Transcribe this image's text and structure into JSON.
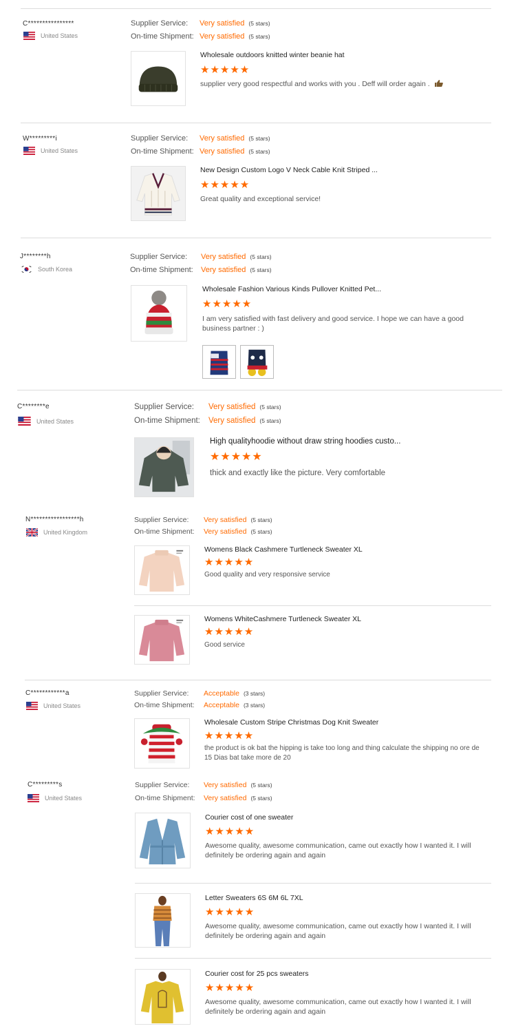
{
  "labels": {
    "supplier_service": "Supplier Service:",
    "ontime_shipment": "On-time Shipment:"
  },
  "colors": {
    "accent": "#ff6a00",
    "divider": "#dcdcdc"
  },
  "reviews": [
    {
      "buyer": "C****************",
      "country": "United States",
      "flag_icon": "us-flag-icon",
      "supplier_service": {
        "value": "Very satisfied",
        "note": "(5 stars)"
      },
      "ontime_shipment": {
        "value": "Very satisfied",
        "note": "(5 stars)"
      },
      "products": [
        {
          "title": "Wholesale outdoors knitted winter beanie hat",
          "rating": "★★★★★",
          "rating_value": 5,
          "comment": "supplier very good respectful and works with you . Deff will order again .",
          "image_icon": "beanie-hat-image"
        }
      ]
    },
    {
      "buyer": "W*********i",
      "country": "United States",
      "flag_icon": "us-flag-icon",
      "supplier_service": {
        "value": "Very satisfied",
        "note": "(5 stars)"
      },
      "ontime_shipment": {
        "value": "Very satisfied",
        "note": "(5 stars)"
      },
      "products": [
        {
          "title": "New Design Custom Logo V Neck Cable Knit Striped ...",
          "rating": "★★★★★",
          "rating_value": 5,
          "comment": "Great quality and exceptional service!",
          "image_icon": "cable-knit-sweater-image"
        }
      ]
    },
    {
      "buyer": "J********h",
      "country": "South Korea",
      "flag_icon": "south-korea-flag-icon",
      "supplier_service": {
        "value": "Very satisfied",
        "note": "(5 stars)"
      },
      "ontime_shipment": {
        "value": "Very satisfied",
        "note": "(5 stars)"
      },
      "products": [
        {
          "title": "Wholesale Fashion Various Kinds Pullover Knitted Pet...",
          "rating": "★★★★★",
          "rating_value": 5,
          "comment": "I am very satisfied with fast delivery and good service. I hope we can have a good business partner : )",
          "image_icon": "pom-pom-hat-image"
        }
      ]
    },
    {
      "buyer": "C********e",
      "country": "United States",
      "flag_icon": "us-flag-icon",
      "supplier_service": {
        "value": "Very satisfied",
        "note": "(5 stars)"
      },
      "ontime_shipment": {
        "value": "Very satisfied",
        "note": "(5 stars)"
      },
      "products": [
        {
          "title": "High qualityhoodie without draw string hoodies custo...",
          "rating": "★★★★★",
          "rating_value": 5,
          "comment": "thick and exactly like the picture. Very comfortable",
          "image_icon": "hoodie-image"
        }
      ]
    },
    {
      "buyer": "N*****************h",
      "country": "United Kingdom",
      "flag_icon": "uk-flag-icon",
      "supplier_service": {
        "value": "Very satisfied",
        "note": "(5 stars)"
      },
      "ontime_shipment": {
        "value": "Very satisfied",
        "note": "(5 stars)"
      },
      "products": [
        {
          "title": "Womens Black Cashmere Turtleneck Sweater XL",
          "rating": "★★★★★",
          "rating_value": 5,
          "comment": "Good quality and very responsive service",
          "image_icon": "beige-sweater-image"
        },
        {
          "title": "Womens WhiteCashmere Turtleneck Sweater XL",
          "rating": "★★★★★",
          "rating_value": 5,
          "comment": "Good service",
          "image_icon": "pink-sweater-image"
        }
      ]
    },
    {
      "buyer": "C************a",
      "country": "United States",
      "flag_icon": "us-flag-icon",
      "supplier_service": {
        "value": "Acceptable",
        "note": "(3 stars)"
      },
      "ontime_shipment": {
        "value": "Acceptable",
        "note": "(3 stars)"
      },
      "products": [
        {
          "title": "Wholesale Custom Stripe Christmas Dog Knit Sweater",
          "rating": "★★★★★",
          "rating_value": 5,
          "comment": "the product is ok bat the hipping is take too long and thing  calculate the shipping no ore de 15 Dias bat take more de 20",
          "image_icon": "christmas-dog-sweater-image"
        }
      ]
    },
    {
      "buyer": "C*********s",
      "country": "United States",
      "flag_icon": "us-flag-icon",
      "supplier_service": {
        "value": "Very satisfied",
        "note": "(5 stars)"
      },
      "ontime_shipment": {
        "value": "Very satisfied",
        "note": "(5 stars)"
      },
      "products": [
        {
          "title": "Courier cost of one sweater",
          "rating": "★★★★★",
          "rating_value": 5,
          "comment": "Awesome quality, awesome communication, came out exactly how I wanted it. I will definitely be ordering again and again",
          "image_icon": "blue-cardigan-image"
        },
        {
          "title": "Letter Sweaters 6S 6M 6L 7XL",
          "rating": "★★★★★",
          "rating_value": 5,
          "comment": "Awesome quality, awesome communication, came out exactly how I wanted it. I will definitely be ordering again and again",
          "image_icon": "model-striped-top-image"
        },
        {
          "title": "Courier cost for 25 pcs sweaters",
          "rating": "★★★★★",
          "rating_value": 5,
          "comment": "Awesome quality, awesome communication, came out exactly how I wanted it. I will definitely be ordering again and again",
          "image_icon": "yellow-sweater-image"
        }
      ]
    }
  ]
}
